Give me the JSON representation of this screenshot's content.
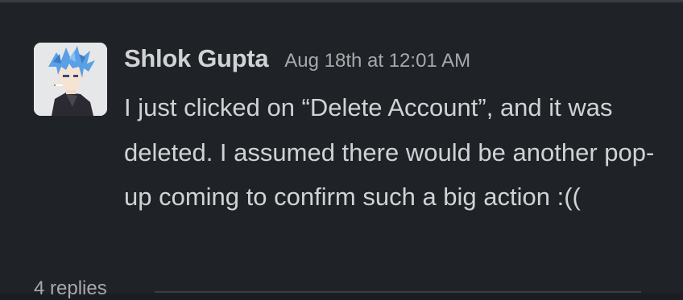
{
  "message": {
    "author": "Shlok Gupta",
    "timestamp": "Aug 18th at 12:01 AM",
    "body": "I just clicked on “Delete Account”, and it was deleted. I assumed there would be another pop-up coming to confirm such a big action :((",
    "replies_label": "4 replies"
  },
  "colors": {
    "background": "#1a1d21",
    "text": "#d1d2d3",
    "muted": "#a8a9ab",
    "avatar_hair": "#5aa0e6"
  },
  "icons": {
    "avatar": "anime-avatar-icon"
  }
}
